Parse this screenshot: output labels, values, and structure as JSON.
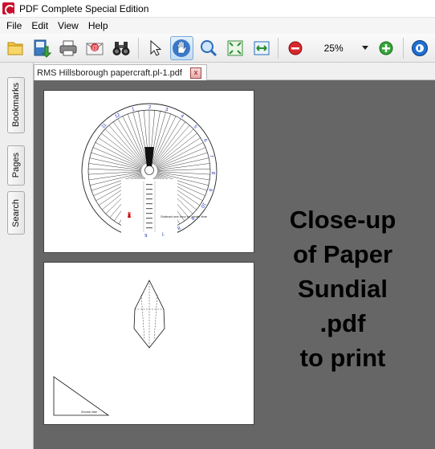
{
  "window": {
    "title": "PDF Complete Special Edition"
  },
  "menu": {
    "items": [
      "File",
      "Edit",
      "View",
      "Help"
    ]
  },
  "toolbar": {
    "zoom_value": "25%",
    "icons": [
      "open-folder",
      "save",
      "print",
      "email",
      "find",
      "select-arrow",
      "hand-tool",
      "zoom-tool",
      "fit-page",
      "fit-width",
      "zoom-out",
      "zoom-in",
      "globe"
    ]
  },
  "tab": {
    "label": "RMS Hillsborough papercraft.pl-1.pdf",
    "close_glyph": "x"
  },
  "side_panel": {
    "tabs": [
      "Bookmarks",
      "Pages",
      "Search"
    ]
  },
  "document": {
    "dial_hours": [
      "11",
      "12",
      "1",
      "2",
      "3",
      "4",
      "5",
      "6",
      "7",
      "8",
      "9",
      "10",
      "9",
      "8",
      "7",
      "6"
    ],
    "north_label": "N",
    "dial_note": "Subtract one hour for winter time",
    "triangle_label": "Gnomon base",
    "caption_lines": [
      "Close-up",
      "of Paper",
      "Sundial",
      ".pdf",
      "to print"
    ]
  },
  "colors": {
    "canvas": "#666666",
    "hour_numbers": "#2233bb",
    "north_arrow": "#cc0000",
    "caption": "#000000"
  }
}
